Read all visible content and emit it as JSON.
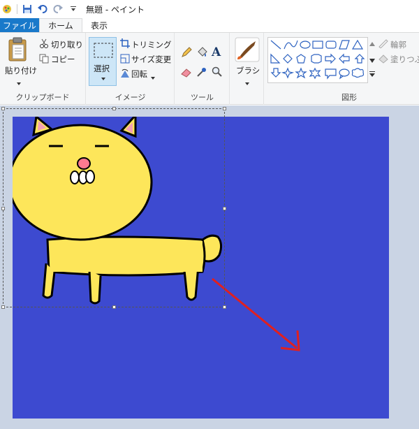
{
  "window": {
    "title": "無題 - ペイント"
  },
  "tabs": {
    "file": "ファイル",
    "home": "ホーム",
    "view": "表示"
  },
  "clipboard": {
    "paste": "貼り付け",
    "cut": "切り取り",
    "copy": "コピー",
    "group": "クリップボード"
  },
  "image": {
    "select": "選択",
    "crop": "トリミング",
    "resize": "サイズ変更",
    "rotate": "回転",
    "group": "イメージ"
  },
  "tools": {
    "group": "ツール",
    "text_glyph": "A"
  },
  "brushes": {
    "label": "ブラシ"
  },
  "shapes": {
    "group": "図形",
    "outline": "輪郭",
    "fill": "塗りつぶし"
  },
  "colors": {
    "accent": "#1979ca",
    "canvas_bg": "#3d4ad0",
    "cat": "#fde65a",
    "arrow": "#e02020"
  }
}
